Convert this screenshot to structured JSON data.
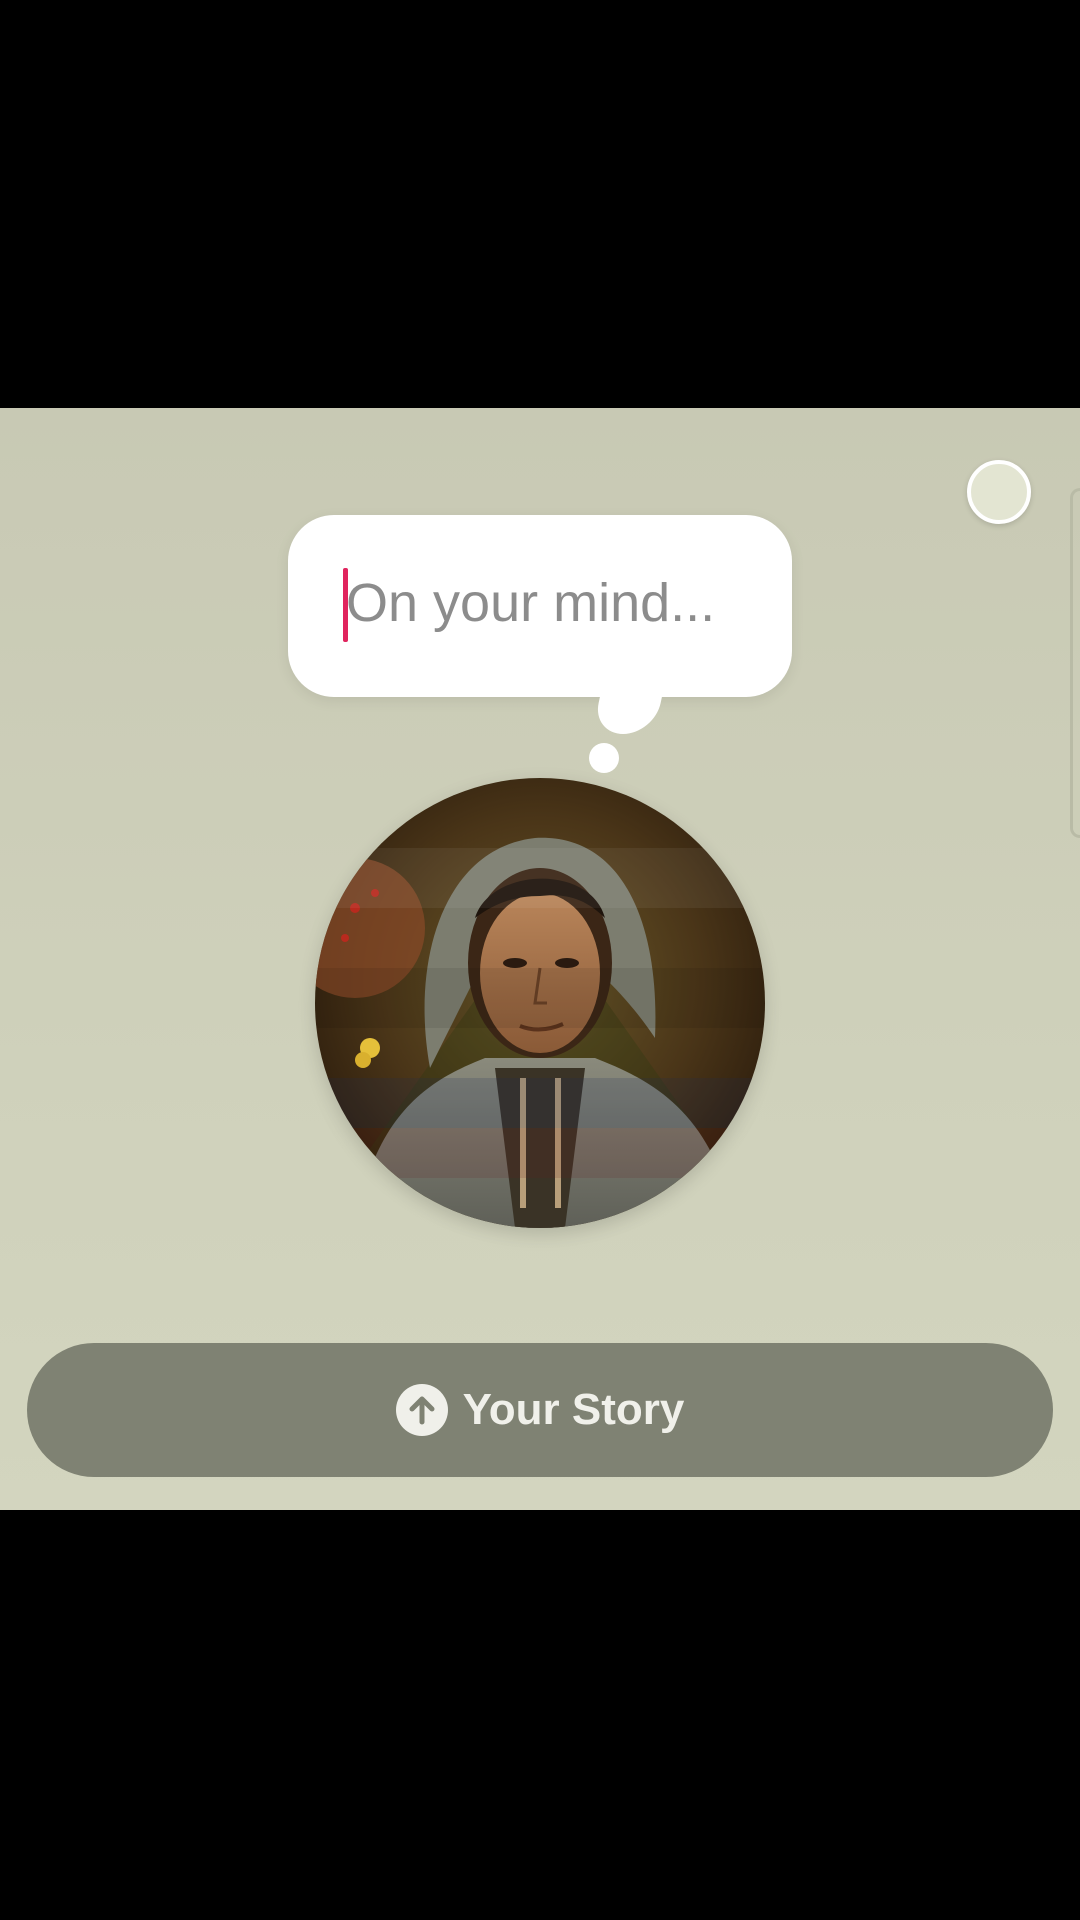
{
  "composer": {
    "placeholder": "On your mind...",
    "accent_color": "#e0245e"
  },
  "color_picker": {
    "selected_color": "#e3e5d2"
  },
  "avatar": {
    "image": "profile-photo"
  },
  "share": {
    "label": "Your Story",
    "icon": "upload-arrow-icon"
  },
  "colors": {
    "background": "#cfd1bb",
    "button": "#7f8273",
    "bubble": "#ffffff"
  }
}
